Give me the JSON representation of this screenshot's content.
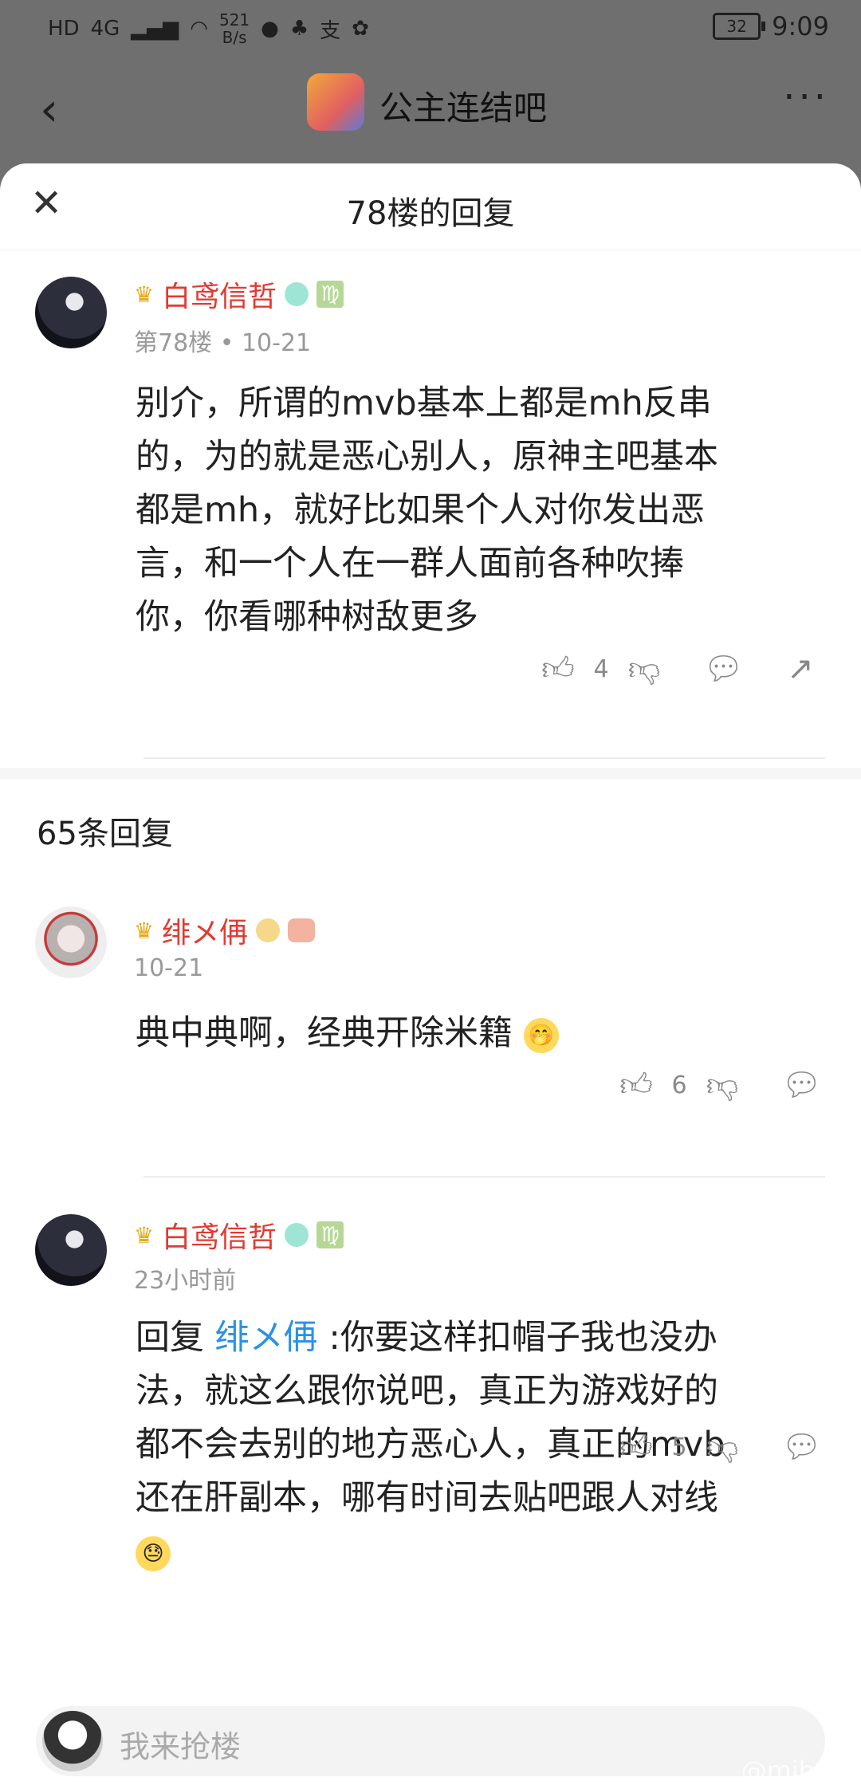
{
  "status_bar": {
    "hd": "HD",
    "network": "4G",
    "speed_value": "521",
    "speed_unit": "B/s",
    "battery": "32",
    "time": "9:09"
  },
  "nav": {
    "forum_title": "公主连结吧",
    "more": "···"
  },
  "sheet": {
    "title": "78楼的回复",
    "main_post": {
      "username": "白鸢信哲",
      "zodiac": "♍",
      "floor": "第78楼",
      "date": "10-21",
      "lines": [
        "别介，所谓的mvb基本上都是mh反串",
        "的，为的就是恶心别人，原神主吧基本",
        "都是mh，就好比如果个人对你发出恶",
        "言，和一个人在一群人面前各种吹捧",
        "你，你看哪种树敌更多"
      ],
      "likes": "4"
    },
    "reply_count_label": "65条回复",
    "replies": [
      {
        "username": "绯メ侢",
        "time": "10-21",
        "text": "典中典啊，经典开除米籍",
        "emoji": "🤭",
        "likes": "6"
      },
      {
        "username": "白鸢信哲",
        "zodiac": "♍",
        "time": "23小时前",
        "prefix": "回复",
        "mention": "绯メ侢",
        "lines": [
          " :你要这样扣帽子我也没办",
          "法，就这么跟你说吧，真正为游戏好的",
          "都不会去别的地方恶心人，真正的mvb",
          "还在肝副本，哪有时间去贴吧跟人对线"
        ],
        "emoji": "😓",
        "likes": "5"
      }
    ]
  },
  "composer": {
    "placeholder": "我来抢楼"
  },
  "watermark": "@mihoyo"
}
